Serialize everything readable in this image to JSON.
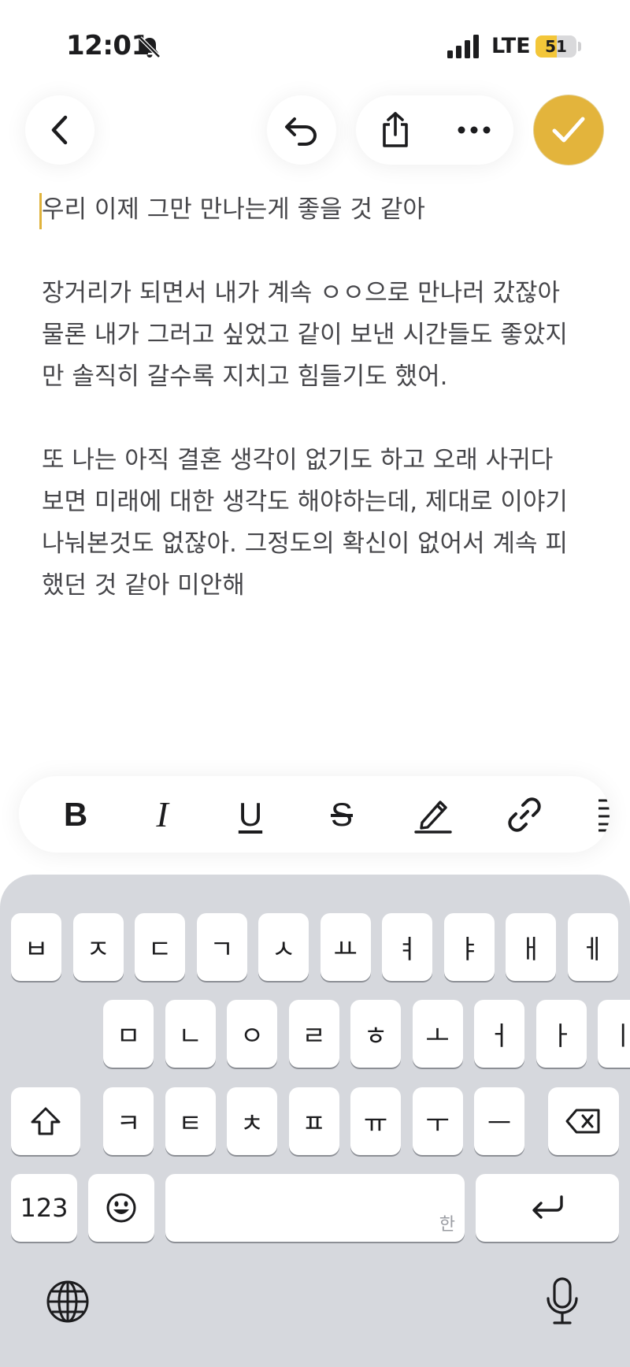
{
  "status_bar": {
    "time": "12:01",
    "silent_icon": "bell-slash-icon",
    "signal_icon": "cellular-signal-icon",
    "network": "LTE",
    "battery_level": 51,
    "battery_text": "51",
    "battery_color": "#f3c639"
  },
  "toolbar": {
    "back_icon": "chevron-left-icon",
    "undo_icon": "undo-arrow-icon",
    "share_icon": "share-icon",
    "more_icon": "more-dots-icon",
    "done_icon": "checkmark-icon",
    "accent_color": "#e3b43c"
  },
  "note": {
    "paragraphs": [
      [
        "우리 이제 그만 만나는게 좋을 것 같아"
      ],
      [
        "장거리가 되면서 내가 계속 ㅇㅇ으로 만나러 갔잖아",
        "물론 내가 그러고 싶었고 같이 보낸 시간들도 좋았지",
        "만 솔직히 갈수록 지치고 힘들기도 했어."
      ],
      [
        "또 나는 아직 결혼 생각이 없기도 하고 오래 사귀다",
        "보면 미래에 대한 생각도 해야하는데, 제대로 이야기",
        "나눠본것도 없잖아. 그정도의 확신이 없어서 계속 피",
        "했던 것 같아 미안해"
      ]
    ]
  },
  "format_bar": {
    "bold_label": "B",
    "italic_label": "I",
    "underline_label": "U",
    "strike_label": "S",
    "items": [
      "bold-icon",
      "italic-icon",
      "underline-icon",
      "strikethrough-icon",
      "highlighter-icon",
      "link-icon",
      "list-icon"
    ]
  },
  "keyboard": {
    "row1": [
      "ㅂ",
      "ㅈ",
      "ㄷ",
      "ㄱ",
      "ㅅ",
      "ㅛ",
      "ㅕ",
      "ㅑ",
      "ㅐ",
      "ㅔ"
    ],
    "row2": [
      "ㅁ",
      "ㄴ",
      "ㅇ",
      "ㄹ",
      "ㅎ",
      "ㅗ",
      "ㅓ",
      "ㅏ",
      "ㅣ"
    ],
    "row3": [
      "ㅋ",
      "ㅌ",
      "ㅊ",
      "ㅍ",
      "ㅠ",
      "ㅜ",
      "ㅡ"
    ],
    "numbers_label": "123",
    "space_hint": "한",
    "shift_icon": "shift-icon",
    "delete_icon": "delete-backspace-icon",
    "emoji_icon": "emoji-icon",
    "return_icon": "return-icon",
    "globe_icon": "globe-icon",
    "mic_icon": "microphone-icon"
  }
}
